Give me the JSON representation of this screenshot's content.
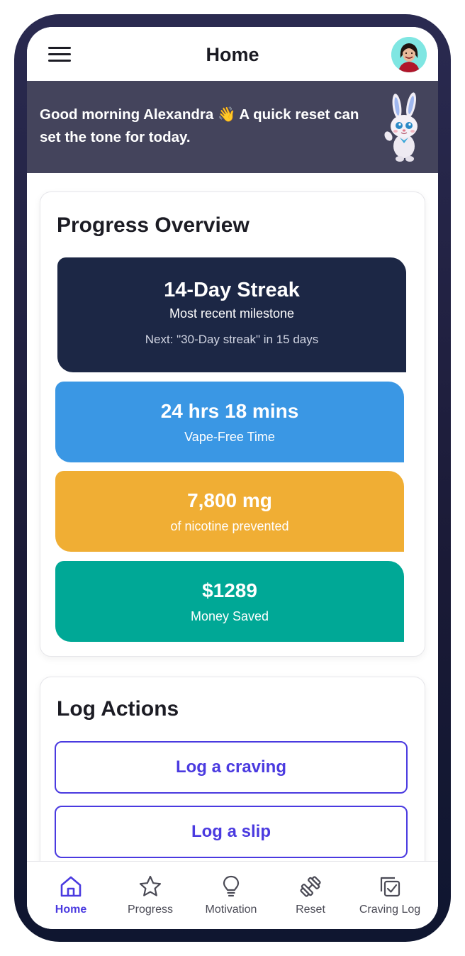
{
  "header": {
    "title": "Home",
    "menu_icon": "hamburger-menu-icon",
    "avatar_icon": "user-avatar"
  },
  "banner": {
    "message": "Good morning Alexandra 👋 A quick reset can set the tone for today.",
    "mascot": "bunny-mascot"
  },
  "progress": {
    "title": "Progress Overview",
    "streak": {
      "value": "14-Day Streak",
      "caption": "Most recent milestone",
      "next": "Next: \"30-Day streak\" in 15 days",
      "color": "#1c2745"
    },
    "vape_free": {
      "value": "24 hrs 18 mins",
      "caption": "Vape-Free Time",
      "color": "#3a97e4"
    },
    "nicotine": {
      "value": "7,800 mg",
      "caption": "of nicotine prevented",
      "color": "#f0ae34"
    },
    "money": {
      "value": "$1289",
      "caption": "Money Saved",
      "color": "#00a896"
    }
  },
  "log_actions": {
    "title": "Log Actions",
    "craving_label": "Log a craving",
    "slip_label": "Log a slip",
    "accent": "#4a3ae0"
  },
  "bottom_nav": {
    "items": [
      {
        "label": "Home",
        "icon": "home-icon",
        "active": true
      },
      {
        "label": "Progress",
        "icon": "star-icon",
        "active": false
      },
      {
        "label": "Motivation",
        "icon": "lightbulb-icon",
        "active": false
      },
      {
        "label": "Reset",
        "icon": "dumbbell-icon",
        "active": false
      },
      {
        "label": "Craving Log",
        "icon": "checklist-icon",
        "active": false
      }
    ]
  }
}
